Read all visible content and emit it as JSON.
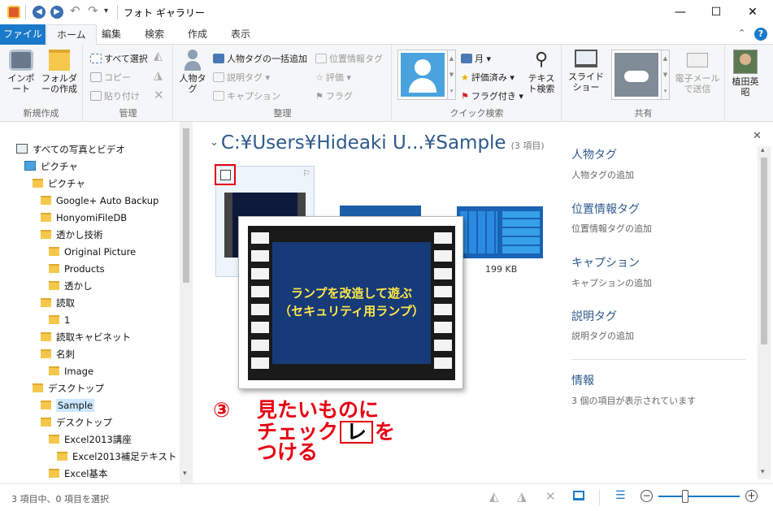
{
  "window": {
    "title": "フォト ギャラリー"
  },
  "tabs": [
    "ファイル",
    "ホーム",
    "編集",
    "検索",
    "作成",
    "表示"
  ],
  "ribbon": {
    "groups": {
      "new": "新規作成",
      "manage": "管理",
      "organize": "整理",
      "quick": "クイック検索",
      "share": "共有"
    },
    "import": "インポート",
    "folder": "フォルダーの作成",
    "select_all": "すべて選択",
    "copy": "コピー",
    "paste": "貼り付け",
    "people": "人物タグ",
    "people_bulk": "人物タグの一括追加",
    "desc_tag": "説明タグ",
    "caption": "キャプション",
    "geo_tag": "位置情報タグ",
    "rating": "評価",
    "flag": "フラグ",
    "month": "月",
    "rated": "評価済み",
    "flagged": "フラグ付き",
    "text_search": "テキスト検索",
    "slideshow": "スライドショー",
    "email": "電子メールで送信",
    "user": "植田英昭"
  },
  "nav": [
    {
      "label": "すべての写真とビデオ",
      "indent": 0,
      "icon": "gallery"
    },
    {
      "label": "ピクチャ",
      "indent": 1,
      "icon": "pictures"
    },
    {
      "label": "ピクチャ",
      "indent": 2
    },
    {
      "label": "Google+ Auto Backup",
      "indent": 3
    },
    {
      "label": "HonyomiFileDB",
      "indent": 3
    },
    {
      "label": "透かし技術",
      "indent": 3
    },
    {
      "label": "Original Picture",
      "indent": 4
    },
    {
      "label": "Products",
      "indent": 4
    },
    {
      "label": "透かし",
      "indent": 4
    },
    {
      "label": "読取",
      "indent": 3
    },
    {
      "label": "1",
      "indent": 4
    },
    {
      "label": "読取キャビネット",
      "indent": 3
    },
    {
      "label": "名刺",
      "indent": 3
    },
    {
      "label": "Image",
      "indent": 4
    },
    {
      "label": "デスクトップ",
      "indent": 2
    },
    {
      "label": "Sample",
      "indent": 3,
      "selected": true
    },
    {
      "label": "デスクトップ",
      "indent": 3
    },
    {
      "label": "Excel2013講座",
      "indent": 4
    },
    {
      "label": "Excel2013補足テキスト",
      "indent": 5
    },
    {
      "label": "Excel基本",
      "indent": 4
    }
  ],
  "content": {
    "path": "C:¥Users¥Hideaki U...¥Sample",
    "count": "(3 項目)",
    "size": "199 KB",
    "thumb_text": [
      "ランプを改造して遊ぶ",
      "（セキュリティ用ランプ）"
    ]
  },
  "details": {
    "people": "人物タグ",
    "people_add": "人物タグの追加",
    "geo": "位置情報タグ",
    "geo_add": "位置情報タグの追加",
    "caption": "キャプション",
    "caption_add": "キャプションの追加",
    "desc": "説明タグ",
    "desc_add": "説明タグの追加",
    "info": "情報",
    "info_text": "3 個の項目が表示されています"
  },
  "annotation": {
    "num": "③",
    "line1": "見たいものに",
    "line2a": "チェック",
    "mark": "レ",
    "line2b": "を",
    "line3": "つける"
  },
  "status": {
    "text": "3 項目中、0 項目を選択"
  }
}
